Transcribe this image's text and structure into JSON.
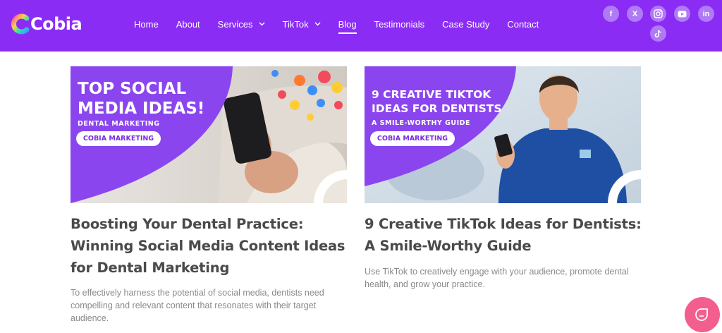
{
  "brand": {
    "logo_text": "Cobia"
  },
  "nav": {
    "items": [
      {
        "label": "Home"
      },
      {
        "label": "About"
      },
      {
        "label": "Services"
      },
      {
        "label": "TikTok"
      },
      {
        "label": "Blog"
      },
      {
        "label": "Testimonials"
      },
      {
        "label": "Case Study"
      },
      {
        "label": "Contact"
      }
    ]
  },
  "social": {
    "facebook": "f",
    "x": "X",
    "instagram": "instagram-icon",
    "youtube": "youtube-icon",
    "linkedin": "in",
    "tiktok": "tiktok-icon"
  },
  "posts": [
    {
      "image": {
        "headline_1": "TOP SOCIAL",
        "headline_2": "MEDIA IDEAS!",
        "subhead": "DENTAL MARKETING",
        "pill": "COBIA MARKETING"
      },
      "title": "Boosting Your Dental Practice: Winning Social Media Content Ideas for Dental Marketing",
      "excerpt": "To effectively harness the potential of social media, dentists need compelling and relevant content that resonates with their target audience."
    },
    {
      "image": {
        "headline_1": "9 CREATIVE TIKTOK",
        "headline_2": "IDEAS FOR DENTISTS",
        "subhead": "A SMILE-WORTHY GUIDE",
        "pill": "COBIA MARKETING"
      },
      "title": "9 Creative TikTok Ideas for Dentists: A Smile-Worthy Guide",
      "excerpt": "Use TikTok to creatively engage with your audience, promote dental health, and grow your practice."
    }
  ],
  "colors": {
    "header_bg": "#8b2cf5",
    "social_bg": "#b07af7",
    "title_text": "#4a4a4a",
    "excerpt_text": "#8a8a8a",
    "chat_button": "#f25f8f"
  }
}
